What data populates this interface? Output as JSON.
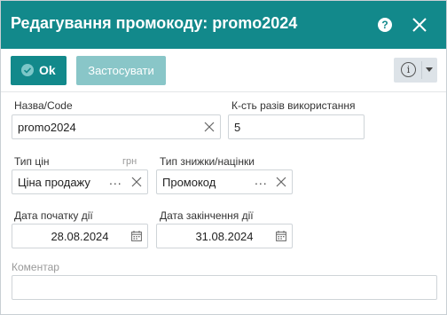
{
  "dialog": {
    "title": "Редагування промокоду: promo2024",
    "help_glyph": "?",
    "close_icon": "close-icon"
  },
  "toolbar": {
    "ok_label": "Ok",
    "apply_label": "Застосувати",
    "info_glyph": "i"
  },
  "form": {
    "name": {
      "label": "Назва/Code",
      "value": "promo2024"
    },
    "usage_count": {
      "label": "К-сть разів використання",
      "value": "5"
    },
    "price_type": {
      "label": "Тип цін",
      "unit": "грн",
      "value": "Ціна продажу",
      "dots": "..."
    },
    "discount_type": {
      "label": "Тип знижки/націнки",
      "value": "Промокод",
      "dots": "..."
    },
    "start_date": {
      "label": "Дата початку дії",
      "value": "28.08.2024"
    },
    "end_date": {
      "label": "Дата закінчення дії",
      "value": "31.08.2024"
    },
    "comment": {
      "label": "Коментар",
      "value": ""
    }
  },
  "colors": {
    "accent": "#12898b",
    "accent_disabled": "#89c6c8"
  }
}
